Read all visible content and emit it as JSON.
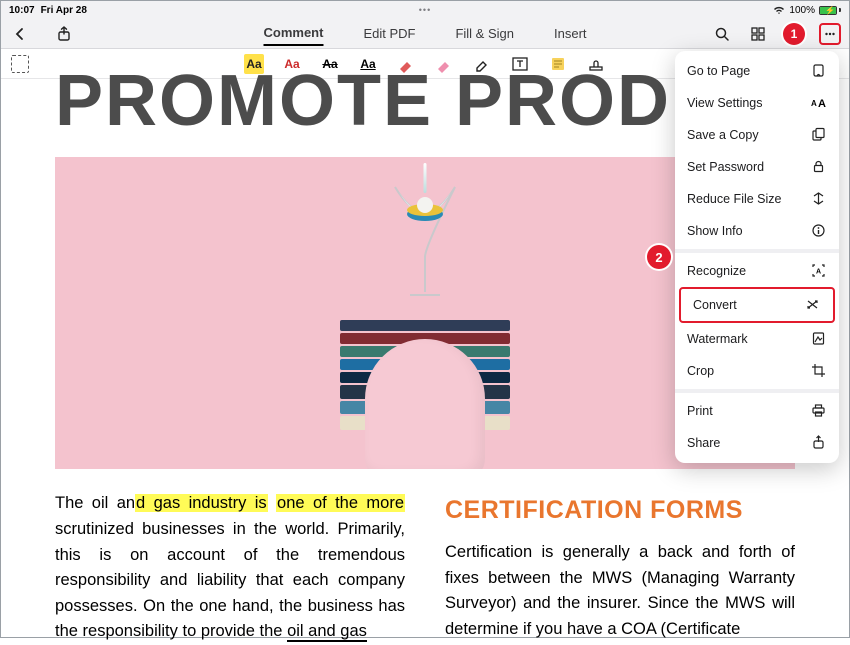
{
  "status": {
    "time": "10:07",
    "date": "Fri Apr 28",
    "battery_pct": "100%"
  },
  "tabs": {
    "comment": "Comment",
    "edit": "Edit PDF",
    "fill": "Fill & Sign",
    "insert": "Insert"
  },
  "badges": {
    "one": "1",
    "two": "2"
  },
  "annotation_tools": {
    "aa": "Aa"
  },
  "menu": {
    "goto": "Go to Page",
    "view": "View Settings",
    "save": "Save a Copy",
    "password": "Set Password",
    "reduce": "Reduce File Size",
    "info": "Show Info",
    "recognize": "Recognize",
    "convert": "Convert",
    "watermark": "Watermark",
    "crop": "Crop",
    "print": "Print",
    "share": "Share"
  },
  "doc": {
    "title": "PROMOTE PRODUCTIV",
    "col1_pre": "The oil an",
    "col1_hl1": "d gas industry is",
    "col1_mid": " ",
    "col1_hl2": "one of the more",
    "col1_rest": " scrutinized businesses in the world. Primarily, this is on account of the tremendous responsibility and liability that each company possesses. On the one hand, the business has the responsibility to provide the ",
    "col1_ul": "oil and gas",
    "cert_heading": "CERTIFICATION FORMS",
    "col2": "Certification is generally a back and forth of fixes between the MWS (Managing Warranty Surveyor) and the insurer. Since the MWS will determine if you have a COA (Certificate"
  },
  "chart_data": null
}
